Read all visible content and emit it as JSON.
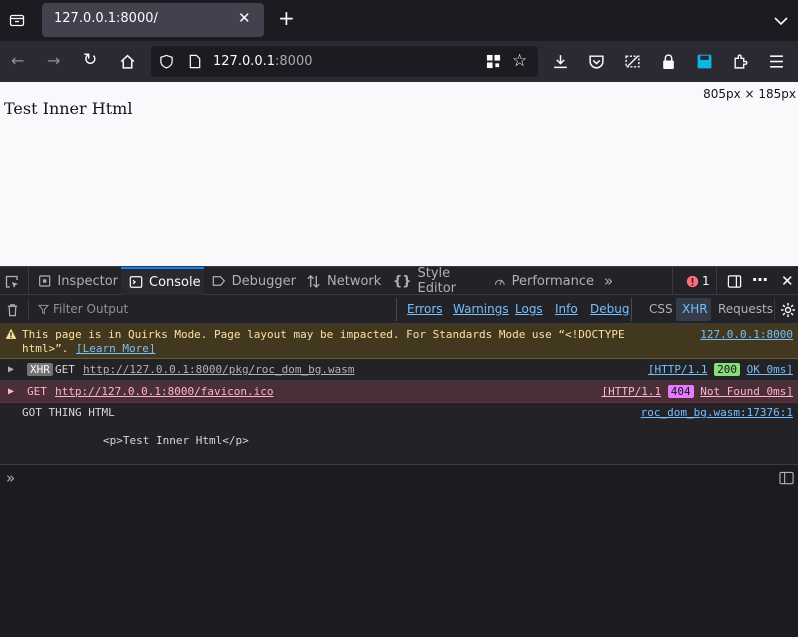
{
  "tab": {
    "title": "127.0.0.1:8000/"
  },
  "urlbar": {
    "host": "127.0.0.1",
    "port": ":8000"
  },
  "page": {
    "text": "Test Inner Html",
    "dimensions": "805px × 185px"
  },
  "devtools": {
    "tabs": [
      "Inspector",
      "Console",
      "Debugger",
      "Network",
      "Style Editor",
      "Performance"
    ],
    "active_tab": "Console",
    "error_count": "1",
    "filter_placeholder": "Filter Output",
    "levels": [
      "Errors",
      "Warnings",
      "Logs",
      "Info",
      "Debug"
    ],
    "extra_filters": [
      "CSS",
      "XHR",
      "Requests"
    ]
  },
  "console": {
    "warning": {
      "text": "This page is in Quirks Mode. Page layout may be impacted. For Standards Mode use “<!DOCTYPE",
      "text2": "html>”.",
      "learn_more": "[Learn More]",
      "source": "127.0.0.1:8000"
    },
    "xhr_msg": {
      "badge": "XHR",
      "method": "GET",
      "url": "http://127.0.0.1:8000/pkg/roc_dom_bg.wasm",
      "status_prefix": "[HTTP/1.1",
      "status_code": "200",
      "status_suffix": "OK 0ms]"
    },
    "error_msg": {
      "method": "GET",
      "url": "http://127.0.0.1:8000/favicon.ico",
      "status_prefix": "[HTTP/1.1",
      "status_code": "404",
      "status_suffix": "Not Found 0ms]"
    },
    "log_msg": {
      "line1": "GOT THING HTML",
      "line2": "<p>Test Inner Html</p>",
      "source": "roc_dom_bg.wasm:17376:1"
    }
  }
}
